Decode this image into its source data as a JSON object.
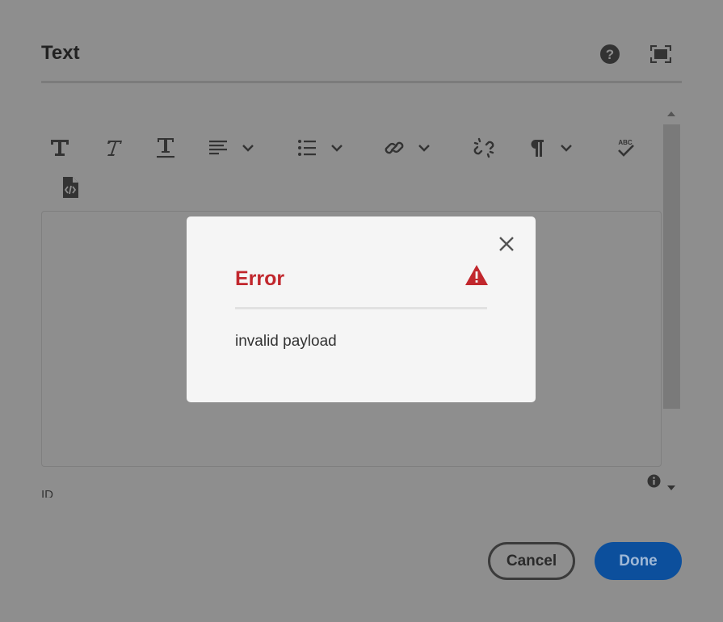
{
  "dialog": {
    "title": "Text",
    "help_icon": "help-circle-icon",
    "fullscreen_icon": "fullscreen-icon"
  },
  "toolbar": {
    "items": [
      {
        "name": "bold",
        "icon": "bold-icon"
      },
      {
        "name": "italic",
        "icon": "italic-icon"
      },
      {
        "name": "underline",
        "icon": "underline-icon"
      },
      {
        "name": "justify",
        "icon": "align-left-icon",
        "dropdown": true
      },
      {
        "name": "lists",
        "icon": "bullet-list-icon",
        "dropdown": true
      },
      {
        "name": "link",
        "icon": "link-icon",
        "dropdown": true
      },
      {
        "name": "unlink",
        "icon": "unlink-icon"
      },
      {
        "name": "paragraph",
        "icon": "paragraph-icon",
        "dropdown": true
      },
      {
        "name": "spellcheck",
        "icon": "spellcheck-icon",
        "label": "ABC"
      },
      {
        "name": "source-edit",
        "icon": "code-file-icon"
      }
    ]
  },
  "field": {
    "label": "ID"
  },
  "buttons": {
    "cancel": "Cancel",
    "done": "Done"
  },
  "modal": {
    "title": "Error",
    "message": "invalid payload",
    "alert_icon": "alert-triangle-icon",
    "close_icon": "close-icon"
  },
  "colors": {
    "overlay": "#8e8e8e",
    "error": "#c1272d",
    "primary": "#0c4f9c",
    "modal_bg": "#f5f5f5"
  }
}
